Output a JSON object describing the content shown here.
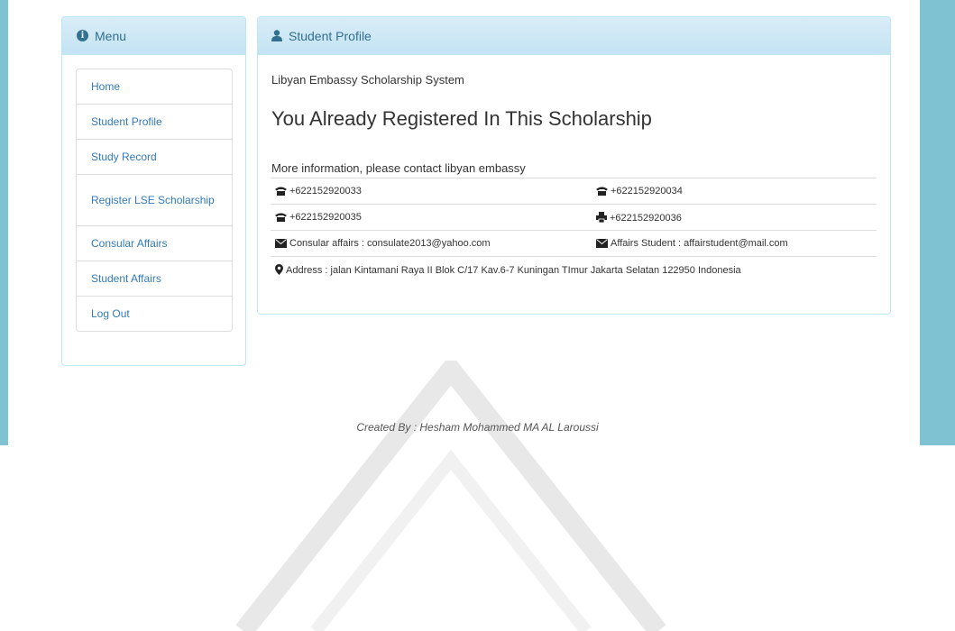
{
  "menu": {
    "title": "Menu",
    "items": [
      {
        "label": "Home"
      },
      {
        "label": "Student Profile"
      },
      {
        "label": "Study Record"
      },
      {
        "label": "Register LSE Scholarship"
      },
      {
        "label": "Consular Affairs"
      },
      {
        "label": "Student Affairs"
      },
      {
        "label": "Log Out"
      }
    ]
  },
  "profile": {
    "title": "Student Profile",
    "subtitle": "Libyan Embassy Scholarship System",
    "headline": "You Already Registered In This Scholarship",
    "more_info": "More information, please contact libyan embassy",
    "contacts": {
      "phone1": "+622152920033",
      "phone2": "+622152920034",
      "phone3": "+622152920035",
      "fax": "+622152920036",
      "consular_email": "Consular affairs : consulate2013@yahoo.com",
      "affairs_email": "Affairs Student : affairstudent@mail.com",
      "address": "Address : jalan Kintamani Raya II Blok C/17 Kav.6-7 Kuningan TImur Jakarta Selatan 122950 Indonesia"
    }
  },
  "footer": {
    "credit": "Created By : Hesham Mohammed MA AL Laroussi"
  },
  "colors": {
    "side_band": "#7fc3d3",
    "panel_heading": "#d9edf7",
    "panel_border": "#bce8f1",
    "link": "#337ab7"
  }
}
